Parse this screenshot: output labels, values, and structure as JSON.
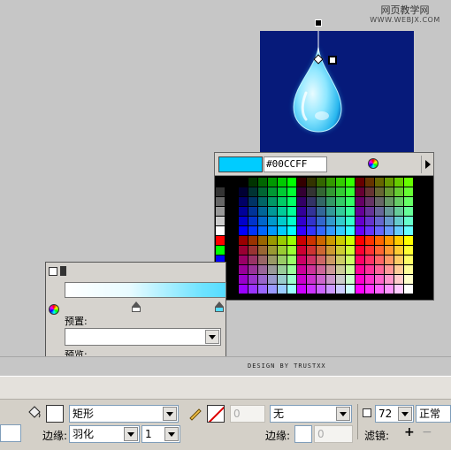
{
  "watermark": {
    "line1": "网页教学网",
    "line2": "WWW.WEBJX.COM"
  },
  "color_picker": {
    "hex_value": "#00CCFF",
    "current_color": "#00ccff",
    "icons": [
      "color-wheel-icon",
      "panel-menu-arrow-icon"
    ]
  },
  "gradient_panel": {
    "preset_label": "预置:",
    "preset_value": "",
    "preview_label": "预览:",
    "stops": [
      "#ffffff",
      "#55dcff"
    ]
  },
  "credit": {
    "text": "DESIGN BY TRUSTXX"
  },
  "properties": {
    "fill_type": "矩形",
    "stroke_opacity": "0",
    "stroke_style": "无",
    "opacity": "72",
    "blend_mode": "正常",
    "edge_label": "边缘:",
    "edge_value": "羽化",
    "feather_value": "1",
    "edge2_label": "边缘:",
    "edge2_value": "0",
    "filters_label": "滤镜:",
    "add_icon": "+",
    "remove_icon": "−"
  }
}
